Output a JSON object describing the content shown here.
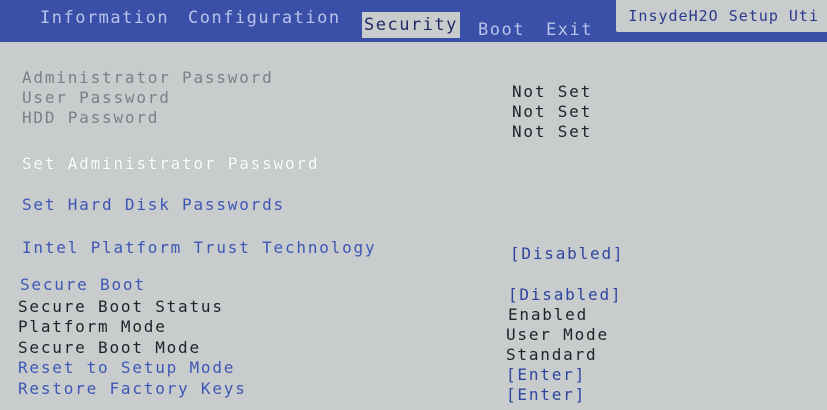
{
  "tabs": [
    "Information",
    "Configuration",
    "Security",
    "Boot",
    "Exit"
  ],
  "brand": "InsydeH2O Setup Uti",
  "items": {
    "admin_pw": "Administrator Password",
    "user_pw": "User Password",
    "hdd_pw": "HDD Password",
    "set_admin_pw": "Set Administrator Password",
    "set_hdd_pw": "Set Hard Disk Passwords",
    "ptt": "Intel Platform Trust Technology",
    "secure_boot": "Secure Boot",
    "secure_boot_status": "Secure Boot Status",
    "platform_mode": "Platform Mode",
    "secure_boot_mode": "Secure Boot Mode",
    "reset_setup_mode": "Reset to Setup Mode",
    "restore_keys": "Restore Factory Keys"
  },
  "values": {
    "admin_pw": "Not Set",
    "user_pw": "Not Set",
    "hdd_pw": "Not Set",
    "ptt": "[Disabled]",
    "secure_boot": "[Disabled]",
    "secure_boot_status": "Enabled",
    "platform_mode": "User Mode",
    "secure_boot_mode": "Standard",
    "reset_setup_mode": "[Enter]",
    "restore_keys": "[Enter]"
  }
}
